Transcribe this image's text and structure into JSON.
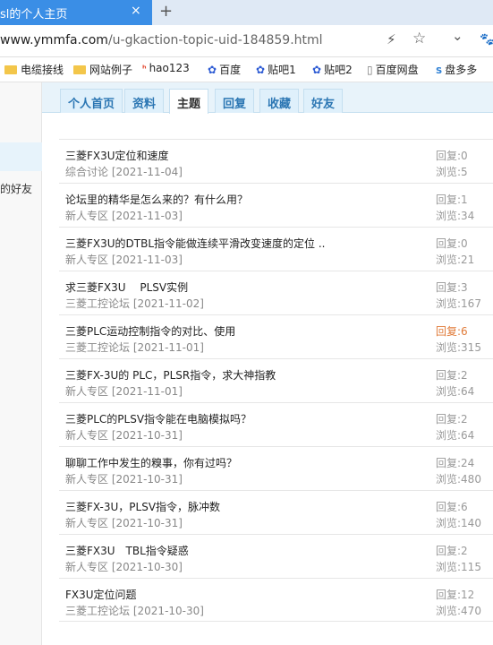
{
  "browser": {
    "tab_title": "sl的个人主页",
    "tab_close": "×",
    "new_tab": "+",
    "url_host": "www.ymmfa.com",
    "url_path": "/u-gkaction-topic-uid-184859.html",
    "icons": {
      "lightning": "⚡",
      "star": "☆",
      "chevron": "⌄",
      "paw": "🐾"
    }
  },
  "bookmarks": [
    {
      "label": "电缆接线",
      "icon": "folder"
    },
    {
      "label": "网站例子",
      "icon": "folder"
    },
    {
      "label": "hao123",
      "icon": "hao123"
    },
    {
      "label": "百度",
      "icon": "paw"
    },
    {
      "label": "贴吧1",
      "icon": "paw"
    },
    {
      "label": "贴吧2",
      "icon": "paw"
    },
    {
      "label": "百度网盘",
      "icon": "page"
    },
    {
      "label": "盘多多",
      "icon": "so"
    }
  ],
  "sidebar": {
    "partial_text": "的好友"
  },
  "nav_tabs": [
    {
      "label": "个人首页",
      "active": false
    },
    {
      "label": "资料",
      "active": false
    },
    {
      "label": "主题",
      "active": true
    },
    {
      "label": "回复",
      "active": false
    },
    {
      "label": "收藏",
      "active": false
    },
    {
      "label": "好友",
      "active": false
    }
  ],
  "topics": [
    {
      "title": "三菱FX3U定位和速度",
      "category": "综合讨论",
      "date": "[2021-11-04]",
      "reply": "回复:0",
      "views": "浏览:5",
      "hot": false
    },
    {
      "title": "论坛里的精华是怎么来的？有什么用？",
      "category": "新人专区",
      "date": "[2021-11-03]",
      "reply": "回复:1",
      "views": "浏览:34",
      "hot": false
    },
    {
      "title": "三菱FX3U的DTBL指令能做连续平滑改变速度的定位 ..",
      "category": "新人专区",
      "date": "[2021-11-03]",
      "reply": "回复:0",
      "views": "浏览:21",
      "hot": false
    },
    {
      "title": "求三菱FX3U　 PLSV实例",
      "category": "三菱工控论坛",
      "date": "[2021-11-02]",
      "reply": "回复:3",
      "views": "浏览:167",
      "hot": false
    },
    {
      "title": "三菱PLC运动控制指令的对比、使用",
      "category": "三菱工控论坛",
      "date": "[2021-11-01]",
      "reply": "回复:6",
      "views": "浏览:315",
      "hot": true
    },
    {
      "title": "三菱FX-3U的 PLC，PLSR指令，求大神指教",
      "category": "新人专区",
      "date": "[2021-11-01]",
      "reply": "回复:2",
      "views": "浏览:64",
      "hot": false
    },
    {
      "title": "三菱PLC的PLSV指令能在电脑模拟吗？",
      "category": "新人专区",
      "date": "[2021-10-31]",
      "reply": "回复:2",
      "views": "浏览:64",
      "hot": false
    },
    {
      "title": "聊聊工作中发生的糗事，你有过吗？",
      "category": "新人专区",
      "date": "[2021-10-31]",
      "reply": "回复:24",
      "views": "浏览:480",
      "hot": false
    },
    {
      "title": "三菱FX-3U，PLSV指令，脉冲数",
      "category": "新人专区",
      "date": "[2021-10-31]",
      "reply": "回复:6",
      "views": "浏览:140",
      "hot": false
    },
    {
      "title": "三菱FX3U　TBL指令疑惑",
      "category": "新人专区",
      "date": "[2021-10-30]",
      "reply": "回复:2",
      "views": "浏览:115",
      "hot": false
    },
    {
      "title": "FX3U定位问题",
      "category": "三菱工控论坛",
      "date": "[2021-10-30]",
      "reply": "回复:12",
      "views": "浏览:470",
      "hot": false
    }
  ]
}
